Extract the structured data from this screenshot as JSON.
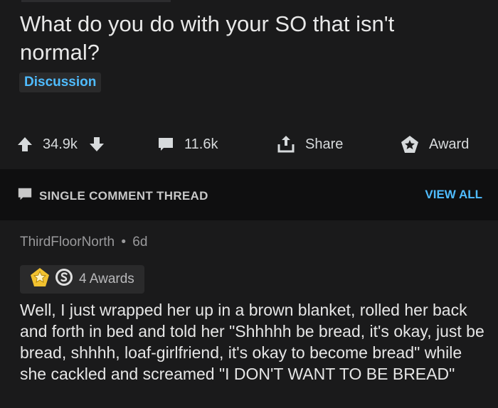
{
  "post": {
    "title": "What do you do with your SO that isn't normal?",
    "flair": "Discussion"
  },
  "actions": {
    "votes": "34.9k",
    "comments": "11.6k",
    "share": "Share",
    "award": "Award"
  },
  "thread": {
    "label": "SINGLE COMMENT THREAD",
    "view_all": "VIEW ALL"
  },
  "comment": {
    "author": "ThirdFloorNorth",
    "separator": "•",
    "age": "6d",
    "awards": "4 Awards",
    "body": "Well, I just wrapped her up in a brown blanket, rolled her back and forth in bed and told her \"Shhhhh be bread, it's okay, just be bread, shhhh, loaf-girlfriend, it's okay to become bread\" while she cackled and screamed \"I DON'T WANT TO BE BREAD\""
  },
  "colors": {
    "background": "#1a1a1b",
    "thread_bar": "#0f0f10",
    "link_blue": "#4fbcff",
    "award_gold": "#f2c230"
  },
  "icons": [
    "upvote-icon",
    "downvote-icon",
    "comment-icon",
    "share-icon",
    "award-icon",
    "gold-award-icon",
    "silver-award-icon"
  ]
}
